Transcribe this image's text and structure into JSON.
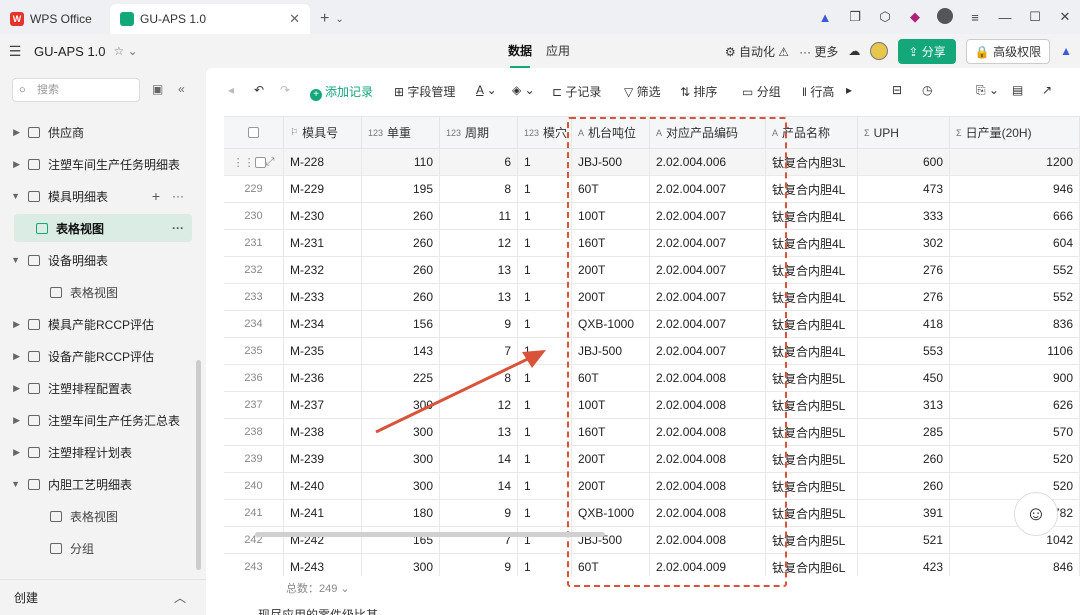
{
  "titlebar": {
    "tabs": [
      {
        "label": "WPS Office"
      },
      {
        "label": "GU-APS 1.0"
      }
    ],
    "new_tab": "+"
  },
  "appbar": {
    "doc_title": "GU-APS 1.0",
    "center_tabs": [
      "数据",
      "应用"
    ],
    "automation": "自动化",
    "more": "更多",
    "share": "分享",
    "permission": "高级权限"
  },
  "sidebar": {
    "search_placeholder": "搜索",
    "items": [
      {
        "label": "供应商"
      },
      {
        "label": "注塑车间生产任务明细表"
      },
      {
        "label": "模具明细表"
      },
      {
        "label": "表格视图"
      },
      {
        "label": "设备明细表"
      },
      {
        "label": "表格视图"
      },
      {
        "label": "模具产能RCCP评估"
      },
      {
        "label": "设备产能RCCP评估"
      },
      {
        "label": "注塑排程配置表"
      },
      {
        "label": "注塑车间生产任务汇总表"
      },
      {
        "label": "注塑排程计划表"
      },
      {
        "label": "内胆工艺明细表"
      },
      {
        "label": "表格视图"
      },
      {
        "label": "分组"
      }
    ],
    "create": "创建"
  },
  "toolbar": {
    "add_record": "添加记录",
    "field_mgmt": "字段管理",
    "sub_record": "子记录",
    "filter": "筛选",
    "sort": "排序",
    "group": "分组",
    "row_height": "行高"
  },
  "table": {
    "columns": [
      "模具号",
      "单重",
      "周期",
      "模穴",
      "机台吨位",
      "对应产品编码",
      "产品名称",
      "UPH",
      "日产量(20H)"
    ],
    "rows": [
      {
        "idx": "228",
        "mold": "M-228",
        "weight": "110",
        "cycle": "6",
        "cavity": "1",
        "tonnage": "JBJ-500",
        "code": "2.02.004.006",
        "name": "钛复合内胆3L",
        "uph": "600",
        "daily": "1200"
      },
      {
        "idx": "229",
        "mold": "M-229",
        "weight": "195",
        "cycle": "8",
        "cavity": "1",
        "tonnage": "60T",
        "code": "2.02.004.007",
        "name": "钛复合内胆4L",
        "uph": "473",
        "daily": "946"
      },
      {
        "idx": "230",
        "mold": "M-230",
        "weight": "260",
        "cycle": "11",
        "cavity": "1",
        "tonnage": "100T",
        "code": "2.02.004.007",
        "name": "钛复合内胆4L",
        "uph": "333",
        "daily": "666"
      },
      {
        "idx": "231",
        "mold": "M-231",
        "weight": "260",
        "cycle": "12",
        "cavity": "1",
        "tonnage": "160T",
        "code": "2.02.004.007",
        "name": "钛复合内胆4L",
        "uph": "302",
        "daily": "604"
      },
      {
        "idx": "232",
        "mold": "M-232",
        "weight": "260",
        "cycle": "13",
        "cavity": "1",
        "tonnage": "200T",
        "code": "2.02.004.007",
        "name": "钛复合内胆4L",
        "uph": "276",
        "daily": "552"
      },
      {
        "idx": "233",
        "mold": "M-233",
        "weight": "260",
        "cycle": "13",
        "cavity": "1",
        "tonnage": "200T",
        "code": "2.02.004.007",
        "name": "钛复合内胆4L",
        "uph": "276",
        "daily": "552"
      },
      {
        "idx": "234",
        "mold": "M-234",
        "weight": "156",
        "cycle": "9",
        "cavity": "1",
        "tonnage": "QXB-1000",
        "code": "2.02.004.007",
        "name": "钛复合内胆4L",
        "uph": "418",
        "daily": "836"
      },
      {
        "idx": "235",
        "mold": "M-235",
        "weight": "143",
        "cycle": "7",
        "cavity": "1",
        "tonnage": "JBJ-500",
        "code": "2.02.004.007",
        "name": "钛复合内胆4L",
        "uph": "553",
        "daily": "1106"
      },
      {
        "idx": "236",
        "mold": "M-236",
        "weight": "225",
        "cycle": "8",
        "cavity": "1",
        "tonnage": "60T",
        "code": "2.02.004.008",
        "name": "钛复合内胆5L",
        "uph": "450",
        "daily": "900"
      },
      {
        "idx": "237",
        "mold": "M-237",
        "weight": "300",
        "cycle": "12",
        "cavity": "1",
        "tonnage": "100T",
        "code": "2.02.004.008",
        "name": "钛复合内胆5L",
        "uph": "313",
        "daily": "626"
      },
      {
        "idx": "238",
        "mold": "M-238",
        "weight": "300",
        "cycle": "13",
        "cavity": "1",
        "tonnage": "160T",
        "code": "2.02.004.008",
        "name": "钛复合内胆5L",
        "uph": "285",
        "daily": "570"
      },
      {
        "idx": "239",
        "mold": "M-239",
        "weight": "300",
        "cycle": "14",
        "cavity": "1",
        "tonnage": "200T",
        "code": "2.02.004.008",
        "name": "钛复合内胆5L",
        "uph": "260",
        "daily": "520"
      },
      {
        "idx": "240",
        "mold": "M-240",
        "weight": "300",
        "cycle": "14",
        "cavity": "1",
        "tonnage": "200T",
        "code": "2.02.004.008",
        "name": "钛复合内胆5L",
        "uph": "260",
        "daily": "520"
      },
      {
        "idx": "241",
        "mold": "M-241",
        "weight": "180",
        "cycle": "9",
        "cavity": "1",
        "tonnage": "QXB-1000",
        "code": "2.02.004.008",
        "name": "钛复合内胆5L",
        "uph": "391",
        "daily": "782"
      },
      {
        "idx": "242",
        "mold": "M-242",
        "weight": "165",
        "cycle": "7",
        "cavity": "1",
        "tonnage": "JBJ-500",
        "code": "2.02.004.008",
        "name": "钛复合内胆5L",
        "uph": "521",
        "daily": "1042"
      },
      {
        "idx": "243",
        "mold": "M-243",
        "weight": "300",
        "cycle": "9",
        "cavity": "1",
        "tonnage": "60T",
        "code": "2.02.004.009",
        "name": "钛复合内胆6L",
        "uph": "423",
        "daily": "846"
      }
    ],
    "total_label": "总数：249"
  },
  "bottom_text": "现尽应用的零件级比甚",
  "colors": {
    "accent": "#13a77a",
    "annotation": "#d9533a"
  }
}
